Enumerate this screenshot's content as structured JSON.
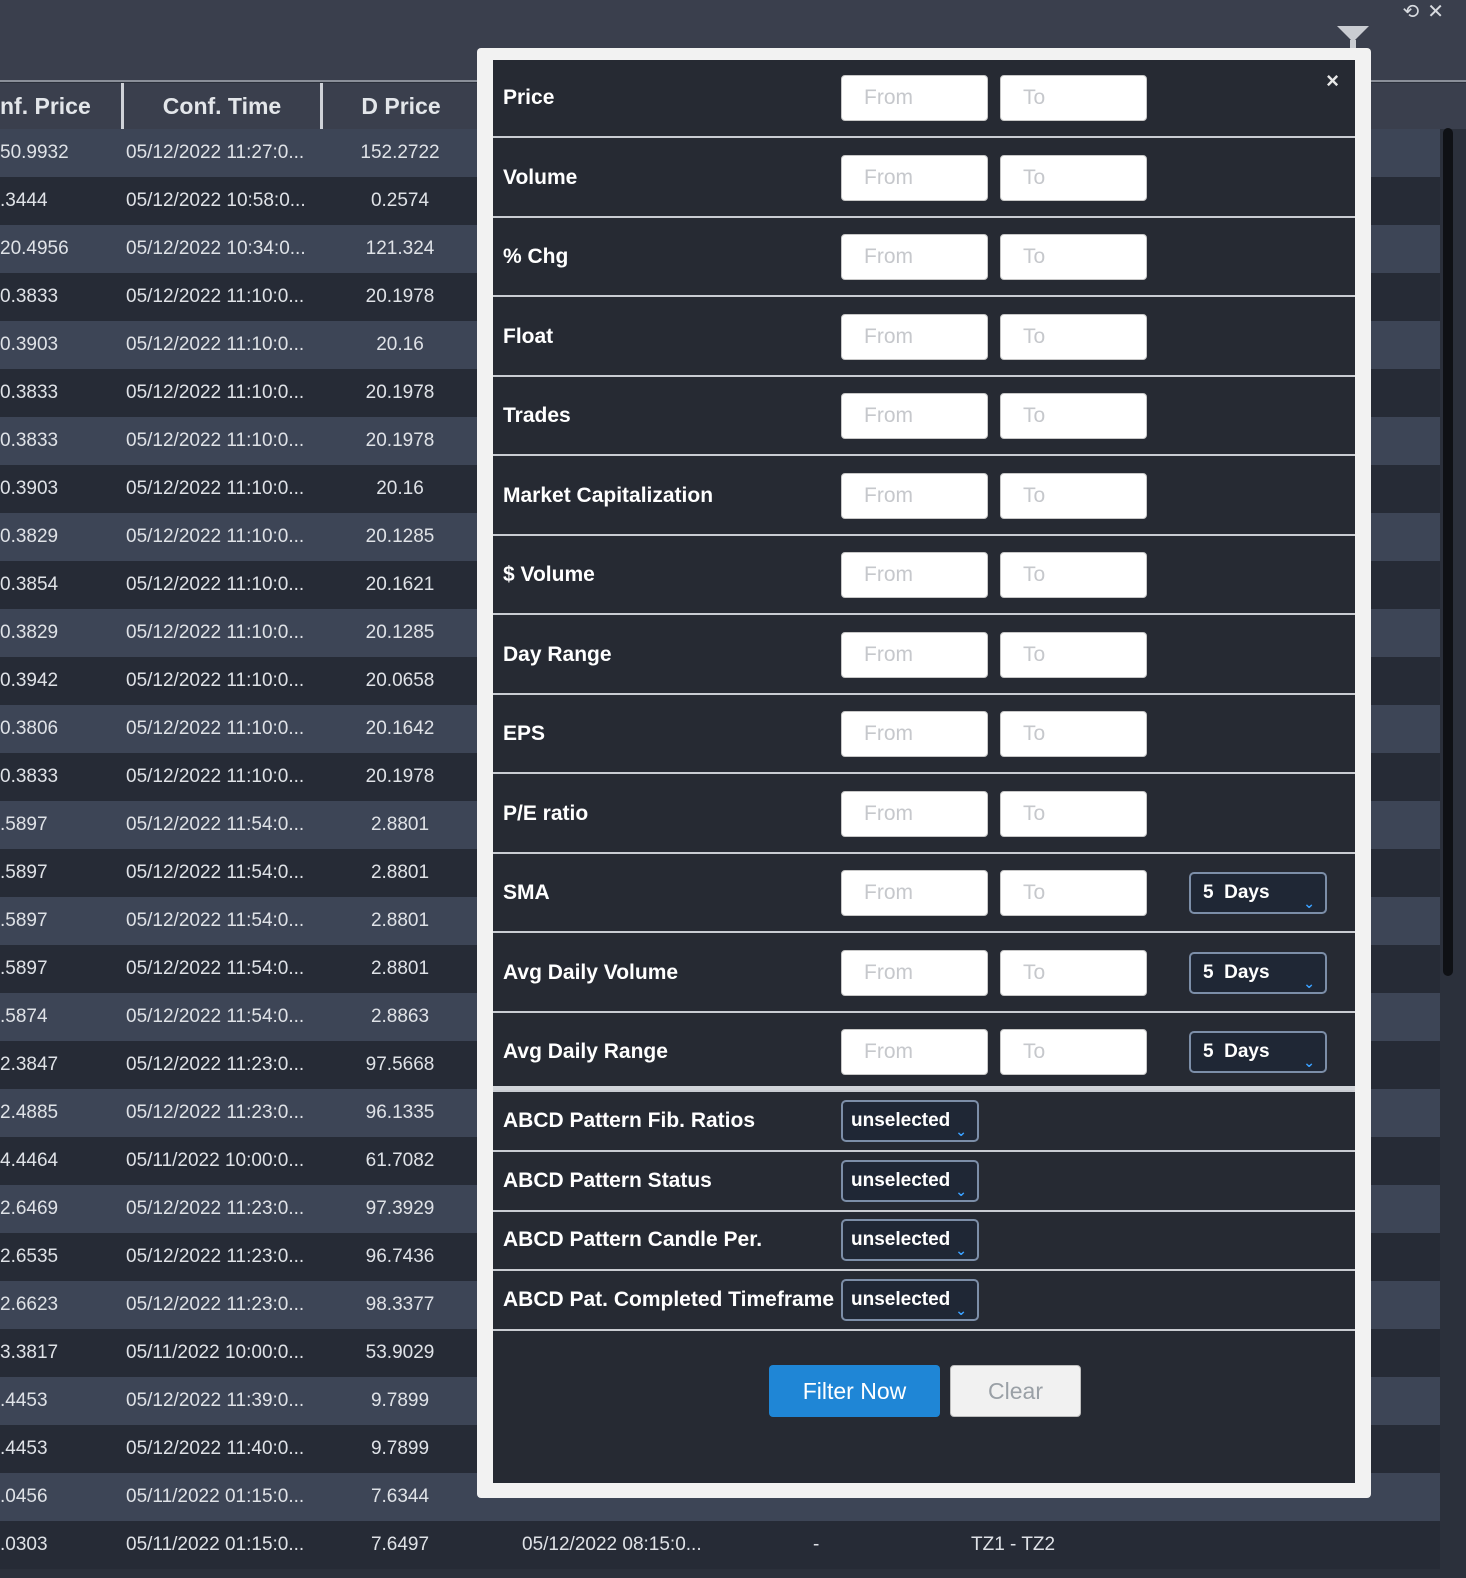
{
  "window": {
    "restore_icon": "⟲",
    "close_icon": "✕"
  },
  "table": {
    "headers": [
      "nf. Price",
      "Conf. Time",
      "D Price"
    ],
    "rows": [
      [
        "50.9932",
        "05/12/2022 11:27:0...",
        "152.2722"
      ],
      [
        ".3444",
        "05/12/2022 10:58:0...",
        "0.2574"
      ],
      [
        "20.4956",
        "05/12/2022 10:34:0...",
        "121.324"
      ],
      [
        "0.3833",
        "05/12/2022 11:10:0...",
        "20.1978"
      ],
      [
        "0.3903",
        "05/12/2022 11:10:0...",
        "20.16"
      ],
      [
        "0.3833",
        "05/12/2022 11:10:0...",
        "20.1978"
      ],
      [
        "0.3833",
        "05/12/2022 11:10:0...",
        "20.1978"
      ],
      [
        "0.3903",
        "05/12/2022 11:10:0...",
        "20.16"
      ],
      [
        "0.3829",
        "05/12/2022 11:10:0...",
        "20.1285"
      ],
      [
        "0.3854",
        "05/12/2022 11:10:0...",
        "20.1621"
      ],
      [
        "0.3829",
        "05/12/2022 11:10:0...",
        "20.1285"
      ],
      [
        "0.3942",
        "05/12/2022 11:10:0...",
        "20.0658"
      ],
      [
        "0.3806",
        "05/12/2022 11:10:0...",
        "20.1642"
      ],
      [
        "0.3833",
        "05/12/2022 11:10:0...",
        "20.1978"
      ],
      [
        ".5897",
        "05/12/2022 11:54:0...",
        "2.8801"
      ],
      [
        ".5897",
        "05/12/2022 11:54:0...",
        "2.8801"
      ],
      [
        ".5897",
        "05/12/2022 11:54:0...",
        "2.8801"
      ],
      [
        ".5897",
        "05/12/2022 11:54:0...",
        "2.8801"
      ],
      [
        ".5874",
        "05/12/2022 11:54:0...",
        "2.8863"
      ],
      [
        "2.3847",
        "05/12/2022 11:23:0...",
        "97.5668"
      ],
      [
        "2.4885",
        "05/12/2022 11:23:0...",
        "96.1335"
      ],
      [
        "4.4464",
        "05/11/2022 10:00:0...",
        "61.7082"
      ],
      [
        "2.6469",
        "05/12/2022 11:23:0...",
        "97.3929"
      ],
      [
        "2.6535",
        "05/12/2022 11:23:0...",
        "96.7436"
      ],
      [
        "2.6623",
        "05/12/2022 11:23:0...",
        "98.3377"
      ],
      [
        "3.3817",
        "05/11/2022 10:00:0...",
        "53.9029"
      ],
      [
        ".4453",
        "05/12/2022 11:39:0...",
        "9.7899"
      ],
      [
        ".4453",
        "05/12/2022 11:40:0...",
        "9.7899"
      ],
      [
        ".0456",
        "05/11/2022 01:15:0...",
        "7.6344"
      ],
      [
        ".0303",
        "05/11/2022 01:15:0...",
        "7.6497"
      ]
    ],
    "last_row_extra": {
      "time": "05/12/2022 08:15:0...",
      "dash": "-",
      "tz": "TZ1 - TZ2"
    }
  },
  "filter": {
    "close_label": "×",
    "from_placeholder": "From",
    "to_placeholder": "To",
    "range_rows": [
      {
        "label": "Price"
      },
      {
        "label": "Volume"
      },
      {
        "label": "% Chg"
      },
      {
        "label": "Float"
      },
      {
        "label": "Trades"
      },
      {
        "label": "Market Capitalization"
      },
      {
        "label": "$ Volume"
      },
      {
        "label": "Day Range"
      },
      {
        "label": "EPS"
      },
      {
        "label": "P/E ratio"
      },
      {
        "label": "SMA",
        "period": "5  Days"
      },
      {
        "label": "Avg Daily Volume",
        "period": "5  Days"
      },
      {
        "label": "Avg Daily Range",
        "period": "5  Days"
      }
    ],
    "select_rows": [
      {
        "label": "ABCD Pattern Fib. Ratios",
        "value": "unselected"
      },
      {
        "label": "ABCD Pattern Status",
        "value": "unselected"
      },
      {
        "label": "ABCD Pattern Candle Per.",
        "value": "unselected"
      },
      {
        "label": "ABCD Pat. Completed Timeframe",
        "value": "unselected"
      }
    ],
    "filter_button": "Filter Now",
    "clear_button": "Clear"
  }
}
